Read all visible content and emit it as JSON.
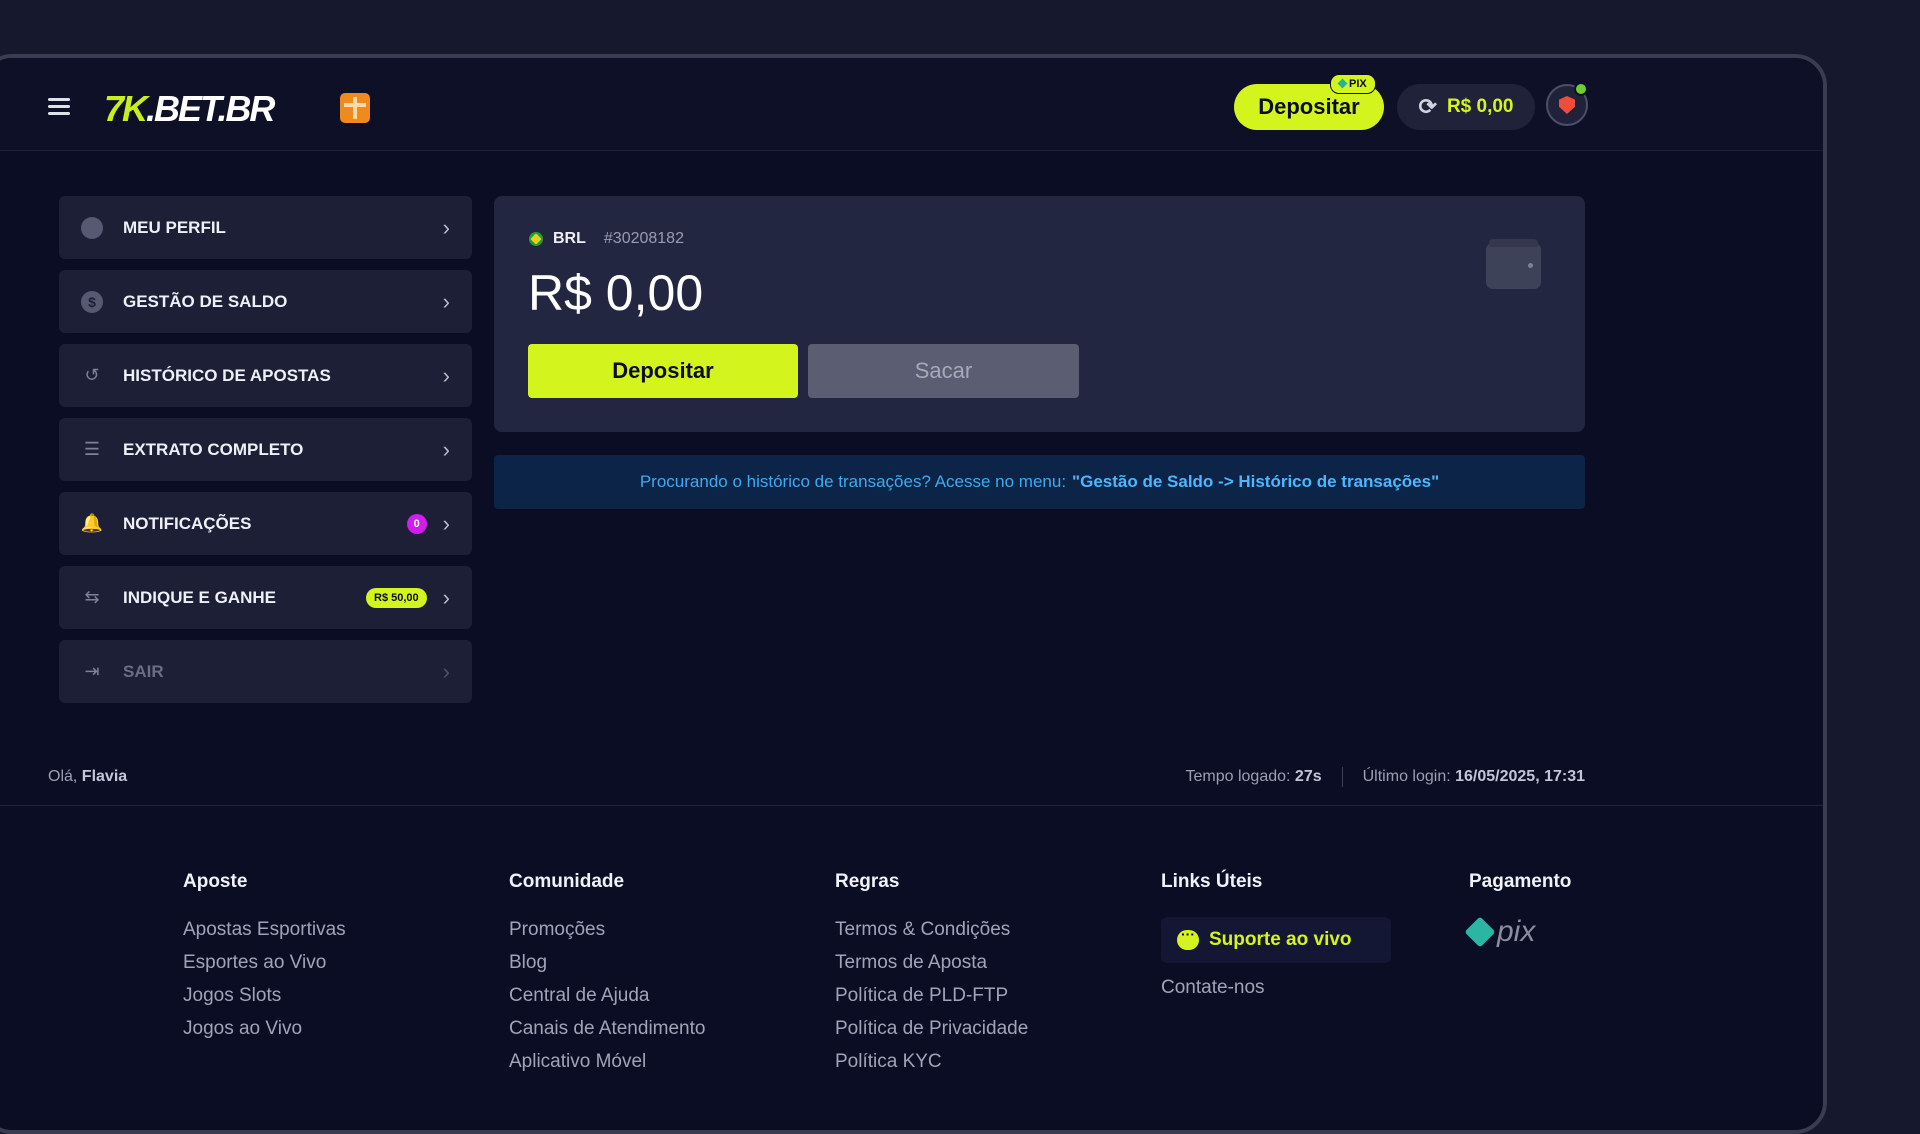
{
  "header": {
    "logo_text_prefix": "7K",
    "logo_text_rest": ".BET.BR",
    "deposit_label": "Depositar",
    "pix_badge": "PIX",
    "balance": "R$ 0,00"
  },
  "menu": {
    "items": [
      {
        "label": "MEU PERFIL"
      },
      {
        "label": "GESTÃO DE SALDO"
      },
      {
        "label": "HISTÓRICO DE APOSTAS"
      },
      {
        "label": "EXTRATO COMPLETO"
      },
      {
        "label": "NOTIFICAÇÕES",
        "badge": "0"
      },
      {
        "label": "INDIQUE E GANHE",
        "badge": "R$ 50,00"
      },
      {
        "label": "SAIR"
      }
    ]
  },
  "wallet": {
    "currency": "BRL",
    "account_id": "#30208182",
    "amount": "R$ 0,00",
    "deposit_label": "Depositar",
    "withdraw_label": "Sacar"
  },
  "info": {
    "text": "Procurando o histórico de transações? Acesse no menu:",
    "link": "\"Gestão de Saldo -> Histórico de transações\""
  },
  "status": {
    "greeting": "Olá,",
    "user": "Flavia",
    "time_label": "Tempo logado:",
    "time_value": "27s",
    "login_label": "Último login:",
    "login_value": "16/05/2025, 17:31"
  },
  "footer": {
    "columns": [
      {
        "title": "Aposte",
        "links": [
          "Apostas Esportivas",
          "Esportes ao Vivo",
          "Jogos Slots",
          "Jogos ao Vivo"
        ]
      },
      {
        "title": "Comunidade",
        "links": [
          "Promoções",
          "Blog",
          "Central de Ajuda",
          "Canais de Atendimento",
          "Aplicativo Móvel"
        ]
      },
      {
        "title": "Regras",
        "links": [
          "Termos & Condições",
          "Termos de Aposta",
          "Política de PLD-FTP",
          "Política de Privacidade",
          "Política KYC"
        ]
      },
      {
        "title": "Links Úteis",
        "support_label": "Suporte ao vivo",
        "links": [
          "Contate-nos"
        ]
      },
      {
        "title": "Pagamento",
        "pix_text": "pix"
      }
    ]
  },
  "colors": {
    "accent": "#d3f51d",
    "background": "#0b0d24",
    "card": "#232640",
    "info_text": "#3fa9ef",
    "notification_badge": "#d21dee"
  }
}
